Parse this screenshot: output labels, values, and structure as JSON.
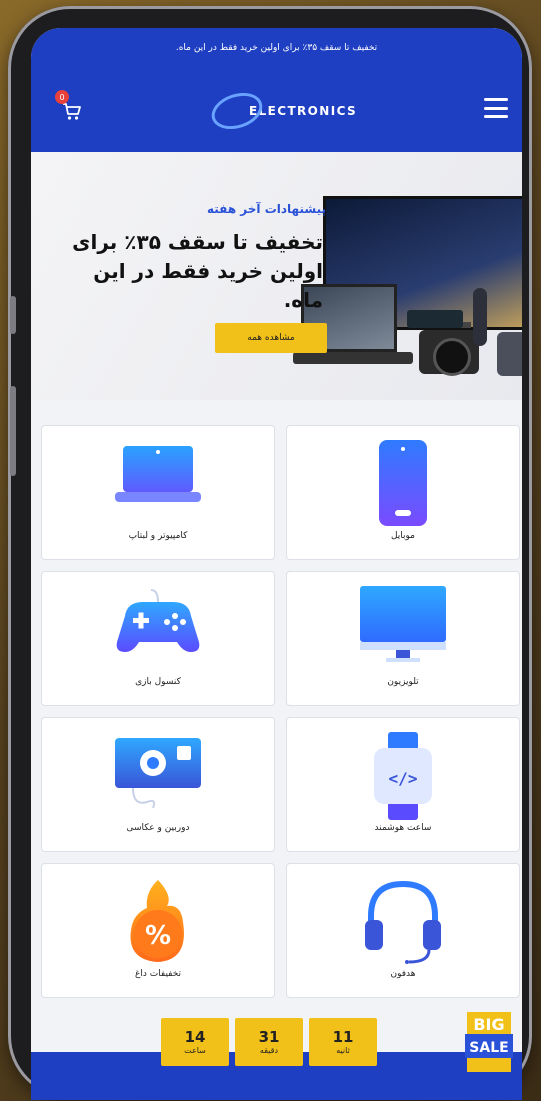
{
  "announcement": "تخفیف تا سقف ۳۵٪ برای اولین خرید فقط در این ماه.",
  "header": {
    "logo_text": "ELECTRONICS",
    "cart_count": "0"
  },
  "hero": {
    "subtitle": "پیشنهادات آخر هفته",
    "title": "تخفیف تا سقف ۳۵٪ برای اولین خرید فقط در این ماه.",
    "button": "مشاهده همه"
  },
  "categories": [
    {
      "label": "موبایل",
      "icon": "mobile-icon"
    },
    {
      "label": "کامپیوتر و لبتاپ",
      "icon": "laptop-icon"
    },
    {
      "label": "تلویزیون",
      "icon": "tv-icon"
    },
    {
      "label": "کنسول بازی",
      "icon": "gamepad-icon"
    },
    {
      "label": "ساعت هوشمند",
      "icon": "smartwatch-icon"
    },
    {
      "label": "دوربین و عکاسی",
      "icon": "camera-icon"
    },
    {
      "label": "هدفون",
      "icon": "headphones-icon"
    },
    {
      "label": "تخفیفات داغ",
      "icon": "hot-discount-icon"
    }
  ],
  "timer": [
    {
      "value": "14",
      "label": "ساعت"
    },
    {
      "value": "31",
      "label": "دقیقه"
    },
    {
      "value": "11",
      "label": "ثانیه"
    }
  ],
  "badge": {
    "line1": "BIG",
    "line2": "SALE"
  },
  "colors": {
    "primary": "#1f3fc3",
    "accent": "#f2c119",
    "icon_blue": "#2f7bff"
  }
}
